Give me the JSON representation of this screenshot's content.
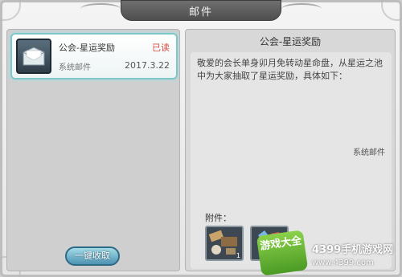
{
  "window": {
    "title": "邮件"
  },
  "mail_list": [
    {
      "title": "公会-星运奖励",
      "status": "已读",
      "sender": "系统邮件",
      "date": "2017.3.22",
      "icon": "envelope-icon"
    }
  ],
  "claim_all_label": "一键收取",
  "detail": {
    "title": "公会-星运奖励",
    "body": "敬爱的会长单身卯月免转动星命盘，从星运之池中为大家抽取了星运奖励，具体如下：",
    "signature": "系统邮件",
    "attachments_label": "附件：",
    "attachments": [
      {
        "name": "reward-pack-1",
        "count": "1"
      },
      {
        "name": "reward-pack-2",
        "count": "1"
      }
    ]
  },
  "watermark": {
    "logo": "游戏大全",
    "name": "4399手机游戏网",
    "url": "www.4399.com"
  },
  "colors": {
    "accent": "#7fc7c9",
    "status_read": "#d14b3f",
    "button": "#4d93b3"
  }
}
